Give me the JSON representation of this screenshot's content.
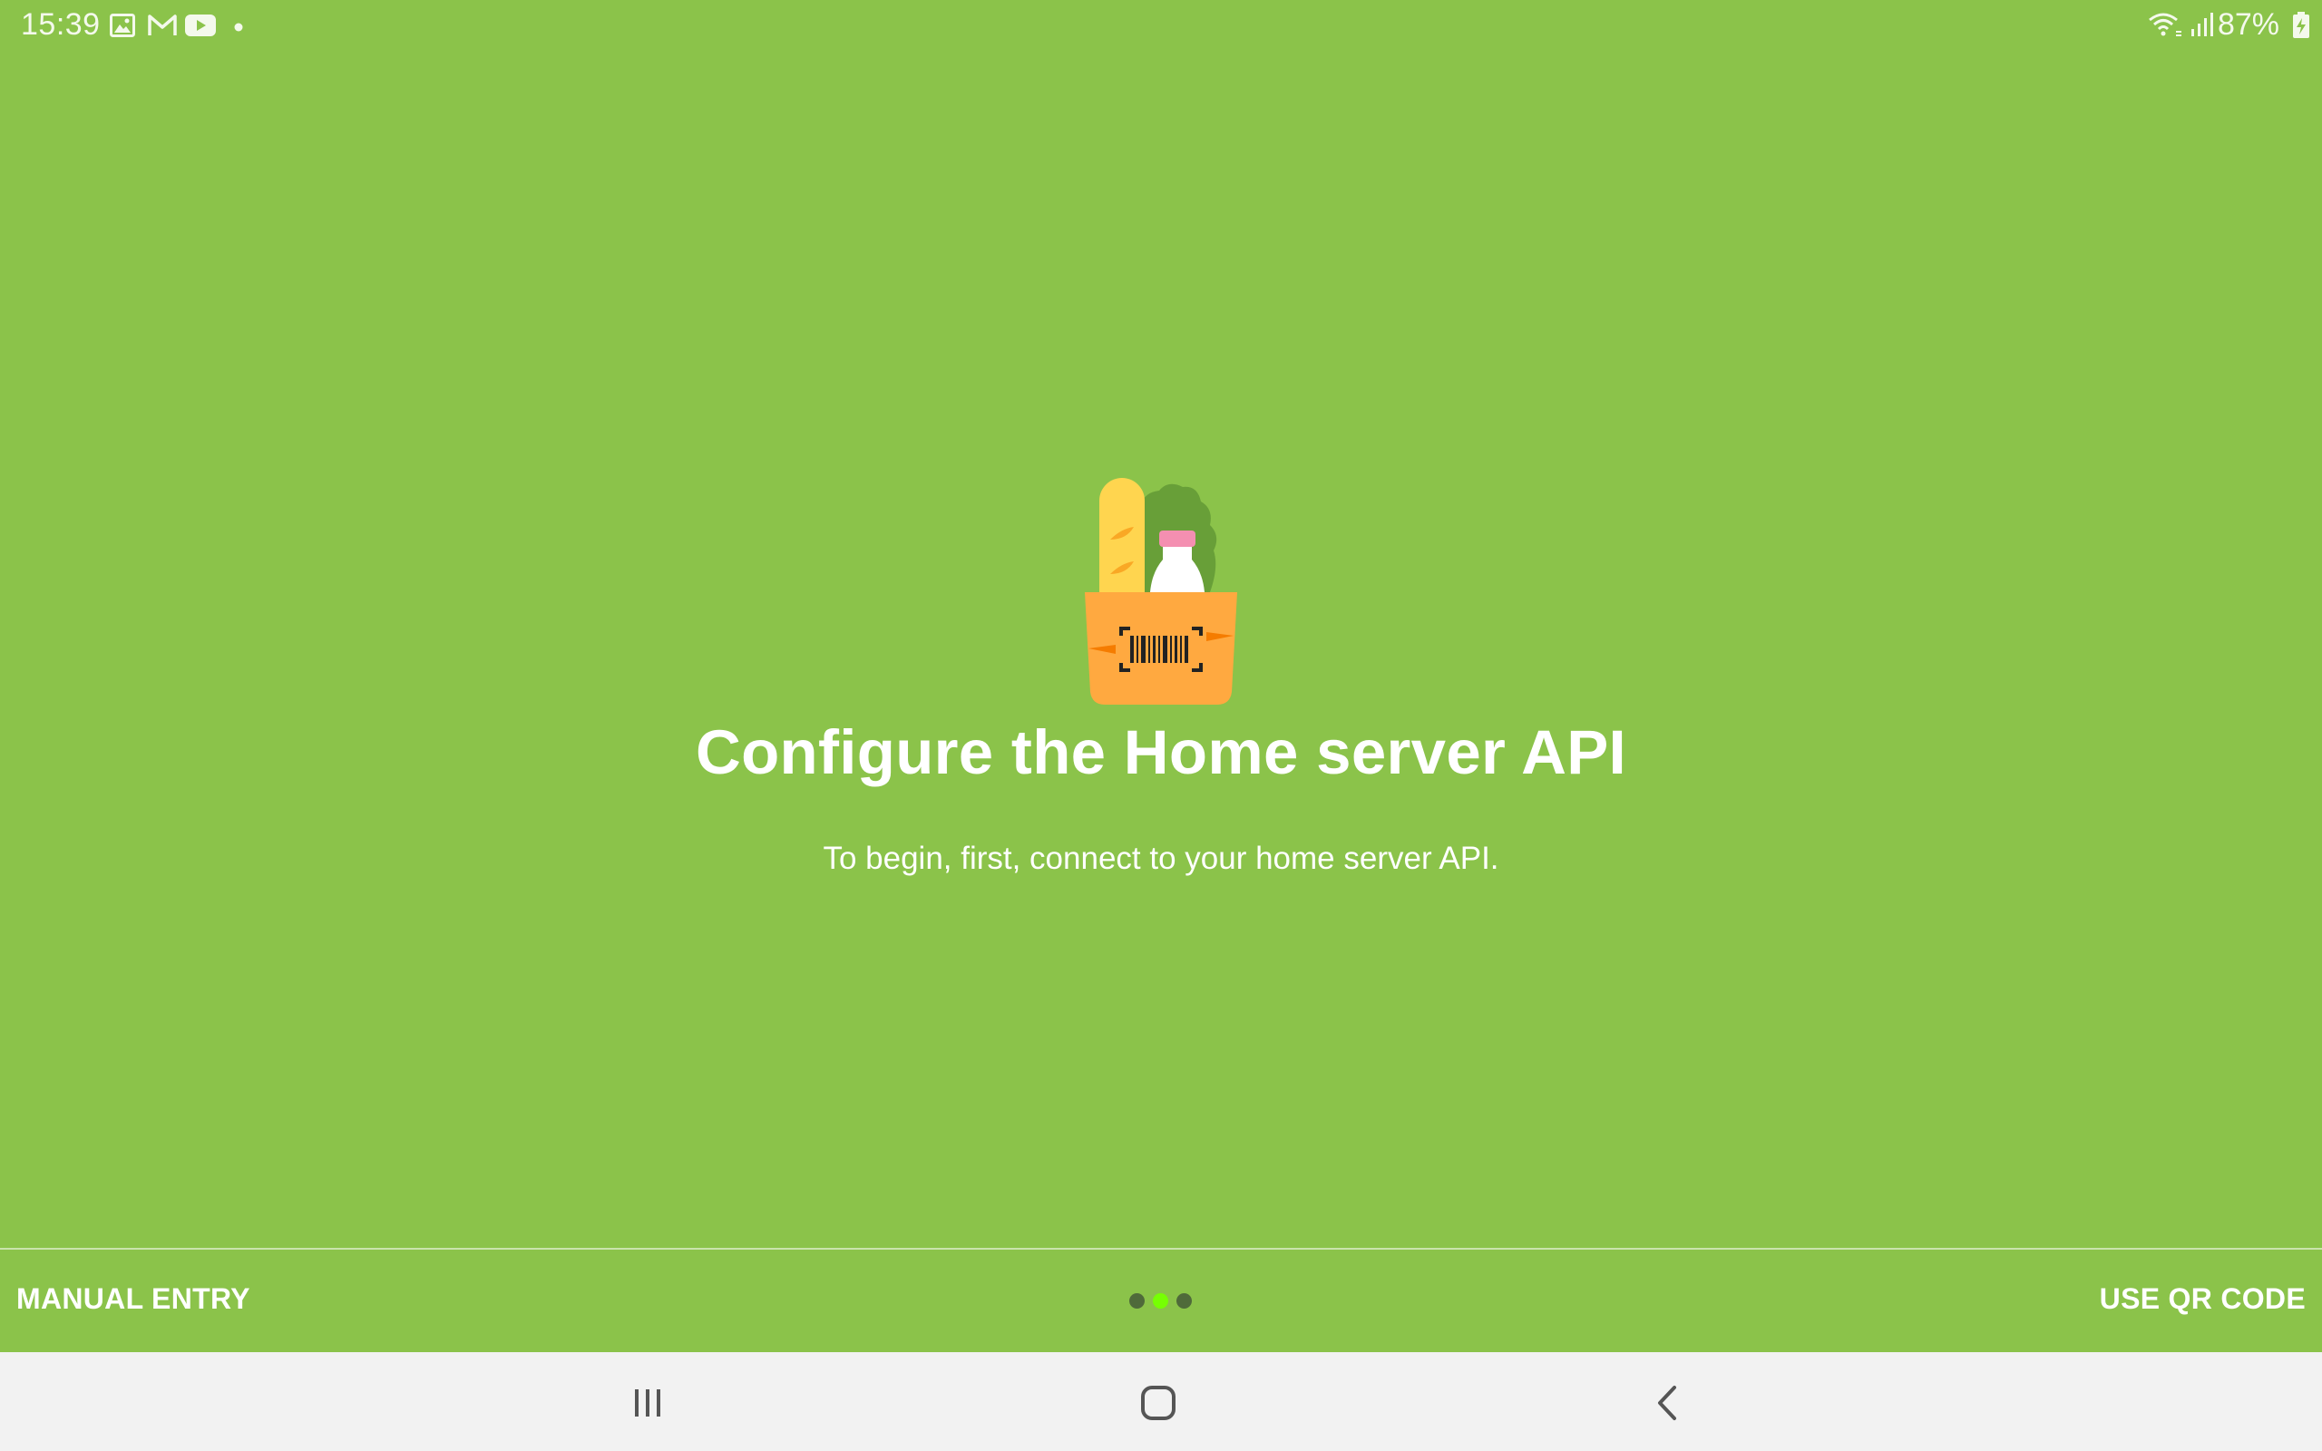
{
  "status_bar": {
    "time": "15:39",
    "notification_icons": [
      "image-icon",
      "gmail-icon",
      "youtube-icon",
      "more-dot-icon"
    ],
    "system_icons": [
      "wifi-icon",
      "cellular-signal-icon",
      "battery-charging-icon"
    ],
    "battery_text": "87%"
  },
  "main": {
    "illustration": "grocery-bag-barcode-icon",
    "title": "Configure the Home server API",
    "subtitle": "To begin, first, connect to your home server API."
  },
  "bottom_bar": {
    "manual_entry_label": "MANUAL ENTRY",
    "qr_code_label": "USE QR CODE",
    "page_indicator": {
      "pages": 3,
      "current": 2
    }
  },
  "nav_bar": {
    "buttons": [
      "recent-apps-icon",
      "home-icon",
      "back-icon"
    ]
  },
  "colors": {
    "background": "#8bc34a",
    "nav_background": "#f2f2f2",
    "dot_active": "#76ff03",
    "dot_inactive": "#4f6a3a",
    "bag": "#ffa940",
    "baguette": "#ffd54f",
    "lettuce": "#689f38",
    "bottle_cap": "#f48fb1"
  }
}
